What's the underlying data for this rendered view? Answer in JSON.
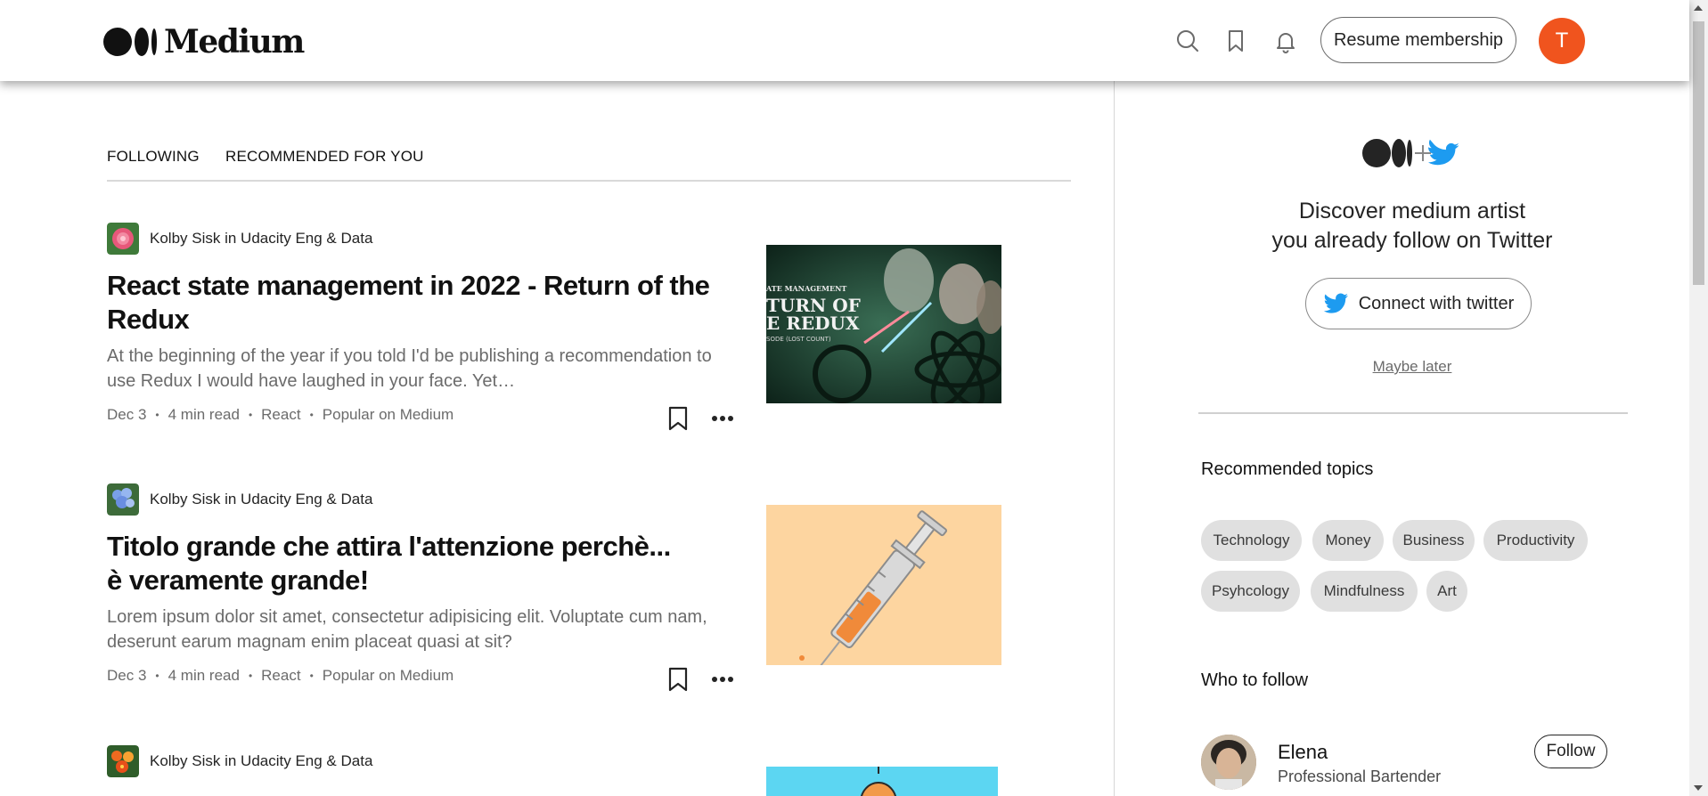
{
  "header": {
    "logo_text": "Medium",
    "icons": [
      "search-icon",
      "bookmarks-icon",
      "notifications-icon"
    ],
    "resume_label": "Resume membership",
    "avatar_letter": "T",
    "avatar_color": "#f0541e"
  },
  "tabs": [
    {
      "label": "FOLLOWING"
    },
    {
      "label": "RECOMMENDED FOR YOU"
    }
  ],
  "articles": [
    {
      "author": "Kolby Sisk",
      "in_word": "in",
      "publication": "Udacity Eng & Data",
      "byline": "Kolby Sisk in Udacity Eng & Data",
      "title": "React state management in 2022 - Return of the Redux",
      "subtitle": "At the beginning of the year if you told I'd be publishing a recommendation to use Redux I would have laughed in your face. Yet…",
      "date": "Dec 3",
      "read_time": "4 min read",
      "topic": "React",
      "badge": "Popular on Medium",
      "thumb_text_1": "ATE MANAGEMENT",
      "thumb_text_2": "TURN OF",
      "thumb_text_3": "E REDUX",
      "thumb_text_4": "SODE (LOST COUNT)"
    },
    {
      "byline": "Kolby Sisk in Udacity Eng & Data",
      "title": "Titolo grande che attira l'attenzione perchè... è veramente grande!",
      "subtitle": "Lorem ipsum dolor sit amet, consectetur adipisicing elit. Voluptate cum nam, deserunt earum magnam enim placeat quasi at sit?",
      "date": "Dec 3",
      "read_time": "4 min read",
      "topic": "React",
      "badge": "Popular on Medium"
    },
    {
      "byline": "Kolby Sisk in Udacity Eng & Data"
    }
  ],
  "sidebar": {
    "discover_line1": "Discover medium artist",
    "discover_line2": "you already follow on Twitter",
    "connect_label": "Connect with twitter",
    "maybe_later": "Maybe later",
    "topics_heading": "Recommended topics",
    "topics": [
      "Technology",
      "Money",
      "Business",
      "Productivity",
      "Psyhcology",
      "Mindfulness",
      "Art"
    ],
    "who_to_follow_heading": "Who to follow",
    "follow": {
      "name": "Elena",
      "description": "Professional Bartender",
      "follow_label": "Follow"
    }
  },
  "colors": {
    "brand_dark": "#111111",
    "twitter_blue": "#1d9bf0",
    "chip_bg": "#e0e0e0",
    "muted_text": "#6b6b6b"
  }
}
